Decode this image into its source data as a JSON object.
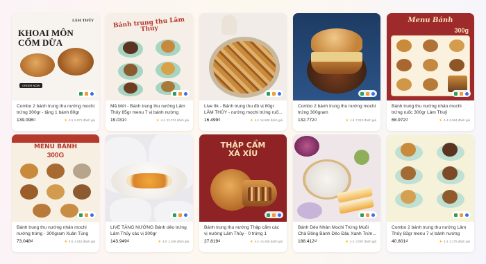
{
  "products": [
    {
      "thumb_title": "KHOAI MÔN\nCỐM DỪA",
      "thumb_brand": "LÂM THỦY",
      "thumb_button": "ORDER NOW",
      "title": "Combo 2 bánh trung thu nướng mochi trứng 300gr - tặng 1 bánh 80gr",
      "price": "139.098₫",
      "rating": "4.5",
      "reviews": "5.071 đánh giá"
    },
    {
      "thumb_title": "Bánh trung thu Lâm Thủy",
      "title": "Mã Mới - Bánh trung thu nướng Lâm Thủy 85gr menu 7 vị bánh nướng",
      "price": "19.031₫",
      "rating": "4.4",
      "reviews": "22.374 đánh giá"
    },
    {
      "title": "Live 9k - Bánh trung thu đủ vị 80gr LÂM THỦY - nướng mochi trứng ruố...",
      "price": "16.499₫",
      "rating": "4.4",
      "reviews": "14.680 đánh giá"
    },
    {
      "title": "Combo 2 bánh trung thu nướng mochi trứng 300gram",
      "price": "132.772₫",
      "rating": "4.6",
      "reviews": "7.013 đánh giá"
    },
    {
      "thumb_title": "Menu Bánh",
      "thumb_sub": "300g",
      "title": "Bánh trung thu nướng nhân mochi trứng ruốc 300gr Lâm Thuỷ",
      "price": "68.972₫",
      "rating": "4.4",
      "reviews": "6.584 đánh giá"
    },
    {
      "thumb_title": "MENU BÁNH",
      "thumb_sub": "300G",
      "title": "Bánh trung thu nướng nhân mochi nướng trứng - 300gram Xuân Tùng",
      "price": "73.048₫",
      "rating": "4.6",
      "reviews": "4.019 đánh giá"
    },
    {
      "title": "LIVE TẶNG NƯỚNG Bánh dẻo trứng Lâm Thủy các vị 300gr",
      "price": "143.949₫",
      "rating": "4.0",
      "reviews": "1.049 đánh giá"
    },
    {
      "thumb_title": "THẬP CẨM\nXÁ XÍU",
      "title": "Bánh trung thu nướng Thập cẩm các vị nướng Lâm Thủy - 0 trứng 1 trứng...",
      "price": "27.819₫",
      "rating": "4.4",
      "reviews": "14.265 đánh giá"
    },
    {
      "title": "Bánh Dẻo Nhân Mochi Trứng Muối Chà Bông Bánh Dẻo Đậu Xanh Trứn...",
      "price": "188.412₫",
      "rating": "4.4",
      "reviews": "3.097 đánh giá"
    },
    {
      "title": "Combo 2 bánh trung thu nướng Lâm Thủy 82gr menu 7 vị bánh nướng",
      "price": "40.801₫",
      "rating": "4.4",
      "reviews": "3.175 đánh giá"
    }
  ],
  "colors": {
    "pill_green": "#2e9d5b",
    "pill_orange": "#f29b38",
    "pill_blue": "#3a6ee8",
    "star": "#f5b400",
    "menu_red": "#9e2a2b",
    "cake_brown": "#b36a2c"
  },
  "icons": [
    "image-icon",
    "edit-icon",
    "info-icon",
    "star-icon"
  ]
}
